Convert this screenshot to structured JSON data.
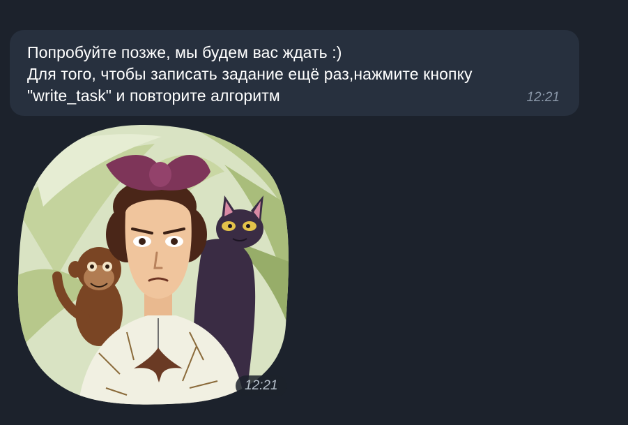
{
  "message": {
    "lines": [
      "Попробуйте позже, мы будем вас ждать :)",
      "Для того, чтобы записать задание ещё раз,нажмите кнопку",
      "\"write_task\" и повторите алгоритм"
    ],
    "time": "12:21"
  },
  "sticker": {
    "icon": "portrait-sticker-woman-with-monkey-and-cat",
    "time": "12:21"
  },
  "colors": {
    "background": "#1c222c",
    "bubble": "#27303e",
    "text": "#ffffff",
    "time": "#8a97a8"
  }
}
